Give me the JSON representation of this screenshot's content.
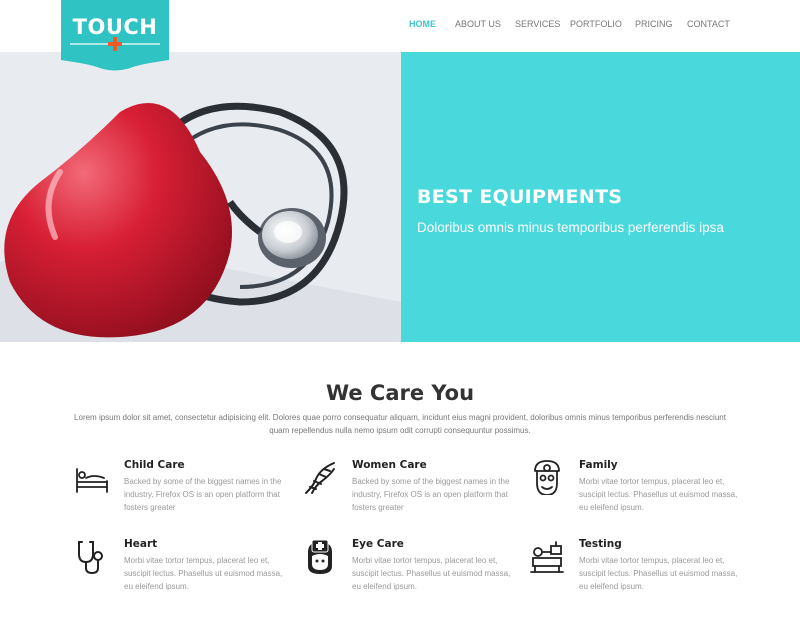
{
  "logo": {
    "text": "TOUCH",
    "icon": "plus-icon",
    "brand_color": "#2fc3c3",
    "accent_color": "#f05a28"
  },
  "nav": {
    "items": [
      {
        "label": "HOME",
        "active": true
      },
      {
        "label": "ABOUT US",
        "active": false
      },
      {
        "label": "SERVICES",
        "active": false
      },
      {
        "label": "PORTFOLIO",
        "active": false
      },
      {
        "label": "PRICING",
        "active": false
      },
      {
        "label": "CONTACT",
        "active": false
      }
    ]
  },
  "hero": {
    "title": "BEST EQUIPMENTS",
    "subtitle": "Doloribus omnis minus temporibus perferendis ipsa",
    "panel_color": "#49d8dc"
  },
  "section": {
    "title": "We Care You",
    "description": "Lorem ipsum dolor sit amet, consectetur adipisicing elit. Dolores quae porro consequatur aliquam, incidunt eius magni provident, doloribus omnis minus temporibus perferendis nesciunt quam repellendus nulla nemo ipsum odit corrupti consequuntur possimus."
  },
  "features": [
    {
      "title": "Child Care",
      "text": "Backed by some of the biggest names in the industry, Firefox OS is an open platform that fosters greater",
      "icon": "hospital-bed-icon"
    },
    {
      "title": "Women Care",
      "text": "Backed by some of the biggest names in the industry, Firefox OS is an open platform that fosters greater",
      "icon": "dna-icon"
    },
    {
      "title": "Family",
      "text": "Morbi vitae tortor tempus, placerat leo et, suscipit lectus. Phasellus ut euismod massa, eu eleifend ipsum.",
      "icon": "doctor-icon"
    },
    {
      "title": "Heart",
      "text": "Morbi vitae tortor tempus, placerat leo et, suscipit lectus. Phasellus ut euismod massa, eu eleifend ipsum.",
      "icon": "stethoscope-icon"
    },
    {
      "title": "Eye Care",
      "text": "Morbi vitae tortor tempus, placerat leo et, suscipit lectus. Phasellus ut euismod massa, eu eleifend ipsum.",
      "icon": "nurse-icon"
    },
    {
      "title": "Testing",
      "text": "Morbi vitae tortor tempus, placerat leo et, suscipit lectus. Phasellus ut euismod massa, eu eleifend ipsum.",
      "icon": "lab-equipment-icon"
    }
  ]
}
